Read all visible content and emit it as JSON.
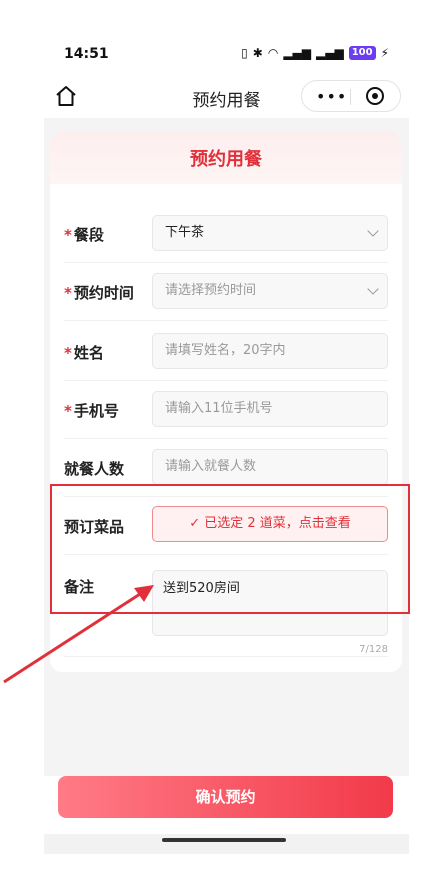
{
  "status_bar": {
    "time": "14:51",
    "battery": "100"
  },
  "navbar": {
    "title": "预约用餐",
    "more_dots": "•••"
  },
  "form": {
    "card_title": "预约用餐",
    "required_mark": "*",
    "meal_period": {
      "label": "餐段",
      "value": "下午茶"
    },
    "reservation_time": {
      "label": "预约时间",
      "placeholder": "请选择预约时间"
    },
    "name": {
      "label": "姓名",
      "placeholder": "请填写姓名，20字内"
    },
    "phone": {
      "label": "手机号",
      "placeholder": "请输入11位手机号"
    },
    "party_size": {
      "label": "就餐人数",
      "placeholder": "请输入就餐人数"
    },
    "dishes": {
      "label": "预订菜品",
      "button_check": "✓",
      "button_text": "已选定 2 道菜，点击查看"
    },
    "remark": {
      "label": "备注",
      "value": "送到520房间",
      "counter": "7/128"
    }
  },
  "confirm_button": "确认预约",
  "annotation_colors": {
    "highlight": "#e0313b",
    "accent": "#e0313b"
  }
}
